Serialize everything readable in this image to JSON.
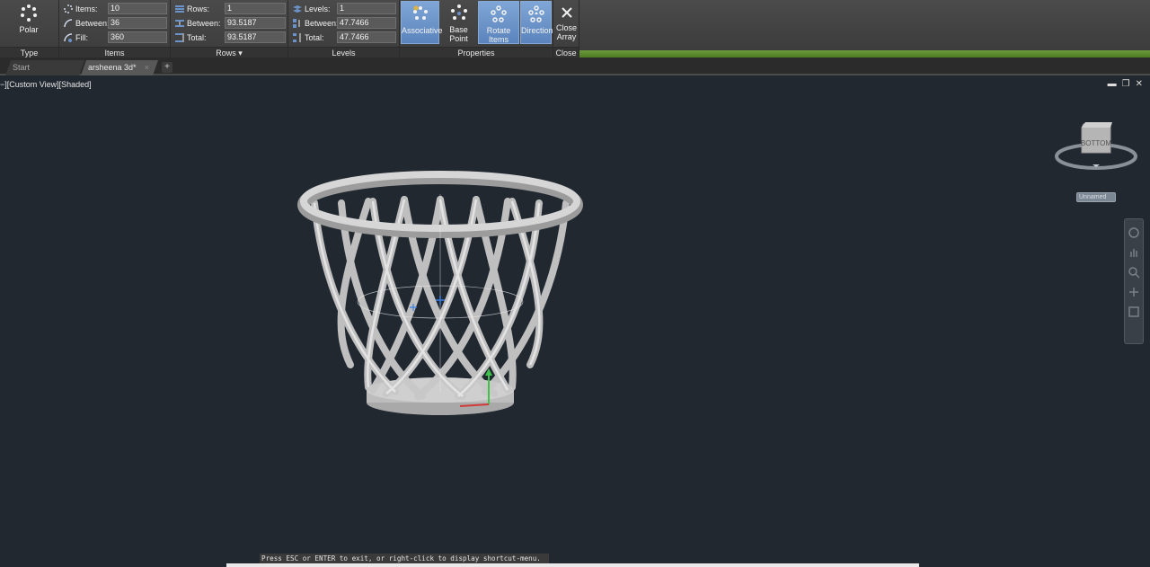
{
  "ribbon": {
    "type_panel": {
      "button_label": "Polar",
      "title": "Type"
    },
    "items_panel": {
      "title": "Items",
      "rows": [
        {
          "label": "Items:",
          "value": "10"
        },
        {
          "label": "Between:",
          "value": "36"
        },
        {
          "label": "Fill:",
          "value": "360"
        }
      ]
    },
    "rows_panel": {
      "title": "Rows",
      "rows": [
        {
          "label": "Rows:",
          "value": "1"
        },
        {
          "label": "Between:",
          "value": "93.5187"
        },
        {
          "label": "Total:",
          "value": "93.5187"
        }
      ]
    },
    "levels_panel": {
      "title": "Levels",
      "rows": [
        {
          "label": "Levels:",
          "value": "1"
        },
        {
          "label": "Between:",
          "value": "47.7466"
        },
        {
          "label": "Total:",
          "value": "47.7466"
        }
      ]
    },
    "properties_panel": {
      "title": "Properties",
      "buttons": [
        {
          "label": "Associative",
          "active": true
        },
        {
          "label": "Base Point",
          "active": false
        },
        {
          "label": "Rotate Items",
          "active": true
        },
        {
          "label": "Direction",
          "active": true
        }
      ]
    },
    "close_panel": {
      "label_line1": "Close",
      "label_line2": "Array",
      "title": "Close"
    }
  },
  "tabs": [
    {
      "label": "Start",
      "active": false
    },
    {
      "label": "arsheena 3d*",
      "active": true
    }
  ],
  "viewport": {
    "view_label": "−][Custom View][Shaded]",
    "viewcube_face": "BOTTOM",
    "ucs_name": "Unnamed"
  },
  "command_line": {
    "prompt": "Press ESC or ENTER to exit, or right-click to display shortcut-menu."
  },
  "colors": {
    "ribbon_bg": "#404040",
    "accent_blue": "#6b93c9",
    "status_green": "#5a8a2e",
    "viewport_bg": "#212830"
  }
}
